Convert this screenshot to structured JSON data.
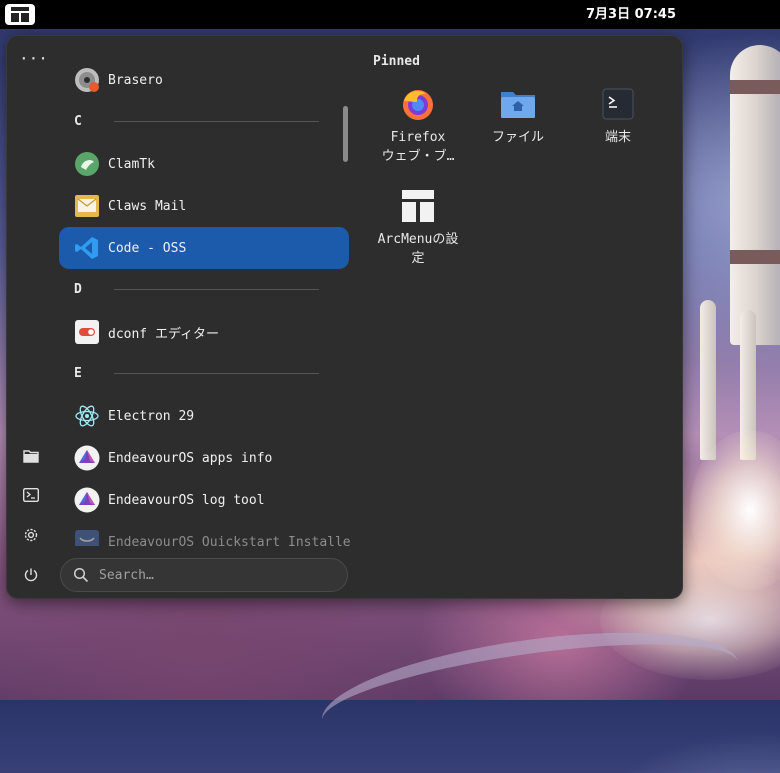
{
  "topbar": {
    "clock": "7月3日 07:45"
  },
  "menu": {
    "more_label": "···",
    "app_list": [
      {
        "type": "app",
        "label": "Brasero",
        "icon": "brasero-icon"
      },
      {
        "type": "header",
        "label": "C"
      },
      {
        "type": "app",
        "label": "ClamTk",
        "icon": "clamtk-icon"
      },
      {
        "type": "app",
        "label": "Claws Mail",
        "icon": "claws-mail-icon"
      },
      {
        "type": "app",
        "label": "Code - OSS",
        "icon": "vscode-icon",
        "selected": true
      },
      {
        "type": "header",
        "label": "D"
      },
      {
        "type": "app",
        "label": "dconf エディター",
        "icon": "dconf-icon"
      },
      {
        "type": "header",
        "label": "E"
      },
      {
        "type": "app",
        "label": "Electron 29",
        "icon": "electron-icon"
      },
      {
        "type": "app",
        "label": "EndeavourOS apps info",
        "icon": "endeavouros-icon"
      },
      {
        "type": "app",
        "label": "EndeavourOS log tool",
        "icon": "endeavouros-icon"
      },
      {
        "type": "app",
        "label": "EndeavourOS Quickstart Installer",
        "icon": "endeavouros-installer-icon"
      }
    ],
    "search": {
      "placeholder": "Search…",
      "value": ""
    },
    "pinned": {
      "title": "Pinned",
      "items": [
        {
          "label_line1": "Firefox",
          "label_line2": "ウェブ・ブ…",
          "icon": "firefox-icon"
        },
        {
          "label_line1": "ファイル",
          "label_line2": "",
          "icon": "files-folder-icon"
        },
        {
          "label_line1": "端末",
          "label_line2": "",
          "icon": "terminal-icon"
        },
        {
          "label_line1": "ArcMenuの設",
          "label_line2": "定",
          "icon": "arcmenu-settings-icon"
        }
      ]
    },
    "side_icons": [
      "home-folder-icon",
      "terminal-icon",
      "settings-gear-icon",
      "power-icon"
    ]
  },
  "colors": {
    "selected_bg": "#1c5bab",
    "menu_bg": "#2d2d2d",
    "topbar_bg": "#000000"
  }
}
